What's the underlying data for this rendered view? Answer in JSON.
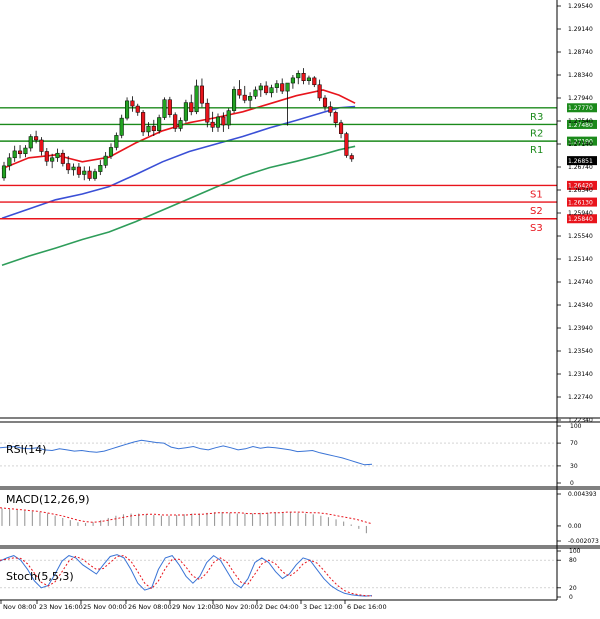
{
  "chart_data": [
    {
      "type": "candlestick",
      "pair": "",
      "ylim": [
        1.2234,
        1.2954
      ],
      "y_ticks": [
        "1.29540",
        "1.29140",
        "1.28740",
        "1.28340",
        "1.27940",
        "1.27540",
        "1.27140",
        "1.26740",
        "1.26340",
        "1.25940",
        "1.25540",
        "1.25140",
        "1.24740",
        "1.24340",
        "1.23940",
        "1.23540",
        "1.23140",
        "1.22740",
        "1.22340"
      ],
      "y_tick_values": [
        1.2954,
        1.2914,
        1.2874,
        1.2834,
        1.2794,
        1.2754,
        1.2714,
        1.2674,
        1.2634,
        1.2594,
        1.2554,
        1.2514,
        1.2474,
        1.2434,
        1.2394,
        1.2354,
        1.2314,
        1.2274,
        1.2234
      ],
      "x_labels": [
        "Nov 08:00",
        "23 Nov 16:00",
        "25 Nov 00:00",
        "26 Nov 08:00",
        "29 Nov 12:00",
        "30 Nov 20:00",
        "2 Dec 04:00",
        "3 Dec 12:00",
        "6 Dec 16:00"
      ],
      "current_price": "1.26851",
      "levels": [
        {
          "label": "R3",
          "value": 1.2777,
          "text": "1.27770",
          "color": "#1b8a1b"
        },
        {
          "label": "R2",
          "value": 1.2748,
          "text": "1.27480",
          "color": "#1b8a1b"
        },
        {
          "label": "R1",
          "value": 1.2719,
          "text": "1.27190",
          "color": "#1b8a1b"
        },
        {
          "label": "S1",
          "value": 1.2642,
          "text": "1.26420",
          "color": "#e8141c"
        },
        {
          "label": "S2",
          "value": 1.2613,
          "text": "1.26130",
          "color": "#e8141c"
        },
        {
          "label": "S3",
          "value": 1.2584,
          "text": "1.25840",
          "color": "#e8141c"
        }
      ],
      "bull_color": "#22a322",
      "bear_color": "#e8141c",
      "candles": [
        [
          1.2655,
          1.2683,
          1.265,
          1.2676
        ],
        [
          1.2676,
          1.2698,
          1.2668,
          1.269
        ],
        [
          1.269,
          1.2711,
          1.2683,
          1.2702
        ],
        [
          1.2702,
          1.2712,
          1.2689,
          1.2697
        ],
        [
          1.2697,
          1.2712,
          1.2691,
          1.2707
        ],
        [
          1.2707,
          1.2731,
          1.2701,
          1.2727
        ],
        [
          1.2727,
          1.2737,
          1.2715,
          1.2721
        ],
        [
          1.2721,
          1.2726,
          1.2694,
          1.2701
        ],
        [
          1.2701,
          1.2707,
          1.2676,
          1.2684
        ],
        [
          1.2684,
          1.2697,
          1.2672,
          1.269
        ],
        [
          1.269,
          1.2706,
          1.2683,
          1.2698
        ],
        [
          1.2698,
          1.2704,
          1.2675,
          1.268
        ],
        [
          1.268,
          1.2693,
          1.2662,
          1.2669
        ],
        [
          1.2669,
          1.268,
          1.2659,
          1.2674
        ],
        [
          1.2674,
          1.2681,
          1.2655,
          1.2661
        ],
        [
          1.2661,
          1.2675,
          1.2651,
          1.2667
        ],
        [
          1.2667,
          1.2675,
          1.265,
          1.2654
        ],
        [
          1.2654,
          1.2671,
          1.265,
          1.2666
        ],
        [
          1.2666,
          1.2686,
          1.266,
          1.2677
        ],
        [
          1.2677,
          1.27,
          1.2672,
          1.2693
        ],
        [
          1.2693,
          1.2715,
          1.2688,
          1.2708
        ],
        [
          1.2708,
          1.2734,
          1.2703,
          1.2729
        ],
        [
          1.2729,
          1.2765,
          1.2724,
          1.2759
        ],
        [
          1.2759,
          1.2795,
          1.2755,
          1.2789
        ],
        [
          1.2789,
          1.2797,
          1.277,
          1.278
        ],
        [
          1.278,
          1.2784,
          1.2763,
          1.2769
        ],
        [
          1.2769,
          1.2773,
          1.2728,
          1.2735
        ],
        [
          1.2735,
          1.2752,
          1.2728,
          1.2745
        ],
        [
          1.2745,
          1.2756,
          1.2728,
          1.2737
        ],
        [
          1.2737,
          1.2765,
          1.2732,
          1.276
        ],
        [
          1.276,
          1.2795,
          1.2756,
          1.2791
        ],
        [
          1.2791,
          1.2796,
          1.276,
          1.2765
        ],
        [
          1.2765,
          1.2769,
          1.2735,
          1.2741
        ],
        [
          1.2741,
          1.276,
          1.2736,
          1.2755
        ],
        [
          1.2755,
          1.2791,
          1.2751,
          1.2786
        ],
        [
          1.2786,
          1.28,
          1.2764,
          1.277
        ],
        [
          1.277,
          1.2826,
          1.2766,
          1.2815
        ],
        [
          1.2815,
          1.2828,
          1.2778,
          1.2785
        ],
        [
          1.2785,
          1.2793,
          1.2743,
          1.2752
        ],
        [
          1.2752,
          1.277,
          1.2735,
          1.2743
        ],
        [
          1.2743,
          1.2767,
          1.2735,
          1.2761
        ],
        [
          1.2761,
          1.2769,
          1.2735,
          1.2747
        ],
        [
          1.2747,
          1.2776,
          1.274,
          1.2772
        ],
        [
          1.2772,
          1.2814,
          1.2768,
          1.2809
        ],
        [
          1.2809,
          1.2825,
          1.2793,
          1.2799
        ],
        [
          1.2799,
          1.2815,
          1.2785,
          1.279
        ],
        [
          1.279,
          1.2804,
          1.2777,
          1.2797
        ],
        [
          1.2797,
          1.2814,
          1.2792,
          1.2808
        ],
        [
          1.2808,
          1.282,
          1.2796,
          1.2815
        ],
        [
          1.2815,
          1.2823,
          1.2799,
          1.2803
        ],
        [
          1.2803,
          1.2817,
          1.2795,
          1.2812
        ],
        [
          1.2812,
          1.2825,
          1.2803,
          1.2819
        ],
        [
          1.2819,
          1.2828,
          1.2801,
          1.2806
        ],
        [
          1.2806,
          1.281,
          1.2746,
          1.282
        ],
        [
          1.282,
          1.2834,
          1.281,
          1.2829
        ],
        [
          1.2829,
          1.2842,
          1.2818,
          1.2837
        ],
        [
          1.2837,
          1.2846,
          1.2818,
          1.2824
        ],
        [
          1.2824,
          1.2833,
          1.2817,
          1.2829
        ],
        [
          1.2829,
          1.2832,
          1.2813,
          1.2817
        ],
        [
          1.2817,
          1.2826,
          1.2789,
          1.2794
        ],
        [
          1.2794,
          1.2799,
          1.2772,
          1.2779
        ],
        [
          1.2779,
          1.2788,
          1.2762,
          1.2769
        ],
        [
          1.2769,
          1.2772,
          1.2743,
          1.2751
        ],
        [
          1.2751,
          1.2756,
          1.2724,
          1.2732
        ],
        [
          1.2732,
          1.2735,
          1.269,
          1.2694
        ],
        [
          1.2694,
          1.2698,
          1.2683,
          1.2688
        ]
      ],
      "ma_lines": [
        {
          "color": "#e8141c",
          "values": [
            [
              0,
              1.2671
            ],
            [
              5,
              1.269
            ],
            [
              10,
              1.2695
            ],
            [
              15,
              1.2683
            ],
            [
              20,
              1.2691
            ],
            [
              25,
              1.2716
            ],
            [
              30,
              1.2737
            ],
            [
              35,
              1.2751
            ],
            [
              40,
              1.276
            ],
            [
              45,
              1.277
            ],
            [
              50,
              1.2784
            ],
            [
              55,
              1.2798
            ],
            [
              60,
              1.2808
            ],
            [
              63,
              1.2799
            ],
            [
              66,
              1.2785
            ]
          ]
        },
        {
          "color": "#3a4fd6",
          "values": [
            [
              0,
              1.2585
            ],
            [
              5,
              1.2601
            ],
            [
              10,
              1.2617
            ],
            [
              15,
              1.2627
            ],
            [
              20,
              1.264
            ],
            [
              25,
              1.2661
            ],
            [
              30,
              1.2683
            ],
            [
              35,
              1.2701
            ],
            [
              40,
              1.2714
            ],
            [
              45,
              1.2727
            ],
            [
              50,
              1.2742
            ],
            [
              55,
              1.2755
            ],
            [
              60,
              1.2769
            ],
            [
              63,
              1.2777
            ],
            [
              66,
              1.2779
            ]
          ]
        },
        {
          "color": "#2e9d5a",
          "values": [
            [
              0,
              1.2503
            ],
            [
              5,
              1.2519
            ],
            [
              10,
              1.2533
            ],
            [
              15,
              1.2548
            ],
            [
              20,
              1.2561
            ],
            [
              25,
              1.2579
            ],
            [
              30,
              1.2599
            ],
            [
              35,
              1.2619
            ],
            [
              40,
              1.2639
            ],
            [
              45,
              1.2658
            ],
            [
              50,
              1.2673
            ],
            [
              55,
              1.2684
            ],
            [
              60,
              1.2696
            ],
            [
              63,
              1.2704
            ],
            [
              66,
              1.271
            ]
          ]
        }
      ]
    },
    {
      "type": "line",
      "title": "RSI(14)",
      "ylim": [
        0,
        100
      ],
      "y_ticks": [
        "100",
        "70",
        "30",
        "0"
      ],
      "y_tick_values": [
        100,
        70,
        30,
        0
      ],
      "series": [
        {
          "color": "#3a74d6",
          "values": [
            62,
            63,
            64,
            61,
            60,
            62,
            58,
            57,
            60,
            58,
            56,
            57,
            55,
            54,
            56,
            60,
            64,
            68,
            72,
            75,
            73,
            71,
            70,
            63,
            60,
            62,
            64,
            60,
            58,
            62,
            65,
            62,
            58,
            60,
            64,
            61,
            63,
            62,
            60,
            58,
            55,
            56,
            57,
            53,
            50,
            47,
            44,
            40,
            36,
            32,
            33
          ]
        }
      ]
    },
    {
      "type": "bar",
      "title": "MACD(12,26,9)",
      "ylim": [
        -0.002073,
        0.004393
      ],
      "y_ticks": [
        "0.004393",
        "0.00",
        "-0.002073"
      ],
      "y_tick_values": [
        0.004393,
        0.0,
        -0.002073
      ],
      "histogram_color": "#999999",
      "signal_color": "#e8141c",
      "histogram": [
        0.0024,
        0.0023,
        0.0022,
        0.0021,
        0.002,
        0.0019,
        0.0017,
        0.0014,
        0.0011,
        0.0008,
        0.0005,
        0.0004,
        0.0005,
        0.0008,
        0.0011,
        0.0014,
        0.0016,
        0.0017,
        0.0017,
        0.0016,
        0.0015,
        0.0014,
        0.0014,
        0.0015,
        0.0016,
        0.0017,
        0.0017,
        0.0018,
        0.0019,
        0.0019,
        0.0018,
        0.0017,
        0.0017,
        0.0017,
        0.0018,
        0.0018,
        0.0019,
        0.0019,
        0.0019,
        0.0018,
        0.0017,
        0.0016,
        0.0014,
        0.0012,
        0.0009,
        0.0006,
        0.0002,
        -0.0004,
        -0.001
      ],
      "signal": [
        0.0025,
        0.0024,
        0.0023,
        0.0022,
        0.0021,
        0.002,
        0.0018,
        0.0016,
        0.0014,
        0.0011,
        0.0008,
        0.0006,
        0.0005,
        0.0006,
        0.0008,
        0.001,
        0.0012,
        0.0014,
        0.0015,
        0.0016,
        0.0016,
        0.0015,
        0.0015,
        0.0015,
        0.0015,
        0.0016,
        0.0016,
        0.0017,
        0.0018,
        0.0018,
        0.0018,
        0.0018,
        0.0017,
        0.0017,
        0.0017,
        0.0018,
        0.0018,
        0.0019,
        0.0019,
        0.0019,
        0.0018,
        0.0018,
        0.0017,
        0.0015,
        0.0013,
        0.0011,
        0.0009,
        0.0006,
        0.0003
      ]
    },
    {
      "type": "line",
      "title": "Stoch(5,5,3)",
      "ylim": [
        0,
        100
      ],
      "y_ticks": [
        "100",
        "80",
        "20",
        "0"
      ],
      "y_tick_values": [
        100,
        80,
        20,
        0
      ],
      "series": [
        {
          "color": "#3a74d6",
          "values": [
            78,
            85,
            90,
            80,
            60,
            35,
            20,
            25,
            50,
            78,
            90,
            85,
            70,
            60,
            50,
            70,
            88,
            92,
            85,
            60,
            30,
            15,
            20,
            60,
            85,
            90,
            70,
            45,
            30,
            45,
            75,
            90,
            80,
            55,
            30,
            20,
            40,
            75,
            85,
            75,
            55,
            40,
            50,
            70,
            85,
            80,
            60,
            40,
            25,
            15,
            8,
            5,
            3,
            2,
            3
          ]
        },
        {
          "color": "#e8141c",
          "dashed": true,
          "values": [
            80,
            82,
            85,
            84,
            72,
            52,
            32,
            24,
            33,
            55,
            78,
            88,
            82,
            70,
            60,
            62,
            75,
            88,
            90,
            78,
            55,
            30,
            18,
            35,
            62,
            82,
            82,
            65,
            45,
            38,
            52,
            75,
            85,
            75,
            52,
            32,
            28,
            50,
            72,
            80,
            72,
            55,
            45,
            55,
            72,
            80,
            74,
            58,
            40,
            25,
            14,
            8,
            5,
            3,
            2
          ]
        }
      ]
    }
  ]
}
